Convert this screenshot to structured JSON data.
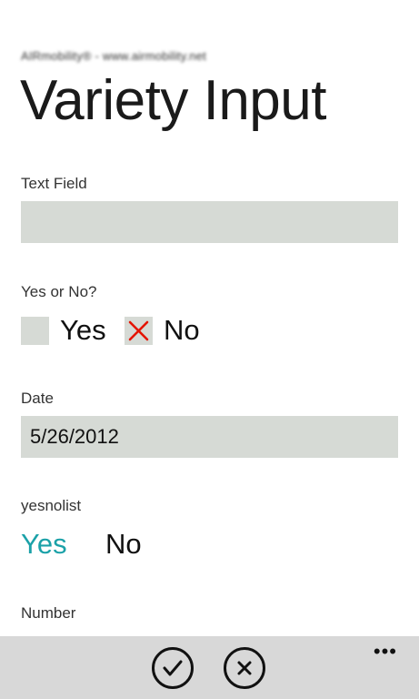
{
  "header": {
    "app_subtitle": "AIRmobility® - www.airmobility.net",
    "page_title": "Variety Input"
  },
  "fields": {
    "text_field": {
      "label": "Text Field",
      "value": ""
    },
    "yes_or_no": {
      "label": "Yes or No?",
      "options": [
        {
          "label": "Yes",
          "checked": false
        },
        {
          "label": "No",
          "checked": true
        }
      ]
    },
    "date": {
      "label": "Date",
      "value": "5/26/2012"
    },
    "yesnolist": {
      "label": "yesnolist",
      "options": [
        {
          "label": "Yes",
          "selected": true
        },
        {
          "label": "No",
          "selected": false
        }
      ]
    },
    "number": {
      "label": "Number"
    }
  },
  "app_bar": {
    "buttons": [
      "check-icon",
      "close-icon"
    ],
    "more": "•••"
  },
  "colors": {
    "accent": "#1ba1a8",
    "field_bg": "#d6dad5",
    "x_mark": "#e51400",
    "app_bar_bg": "#d8d8d8"
  }
}
